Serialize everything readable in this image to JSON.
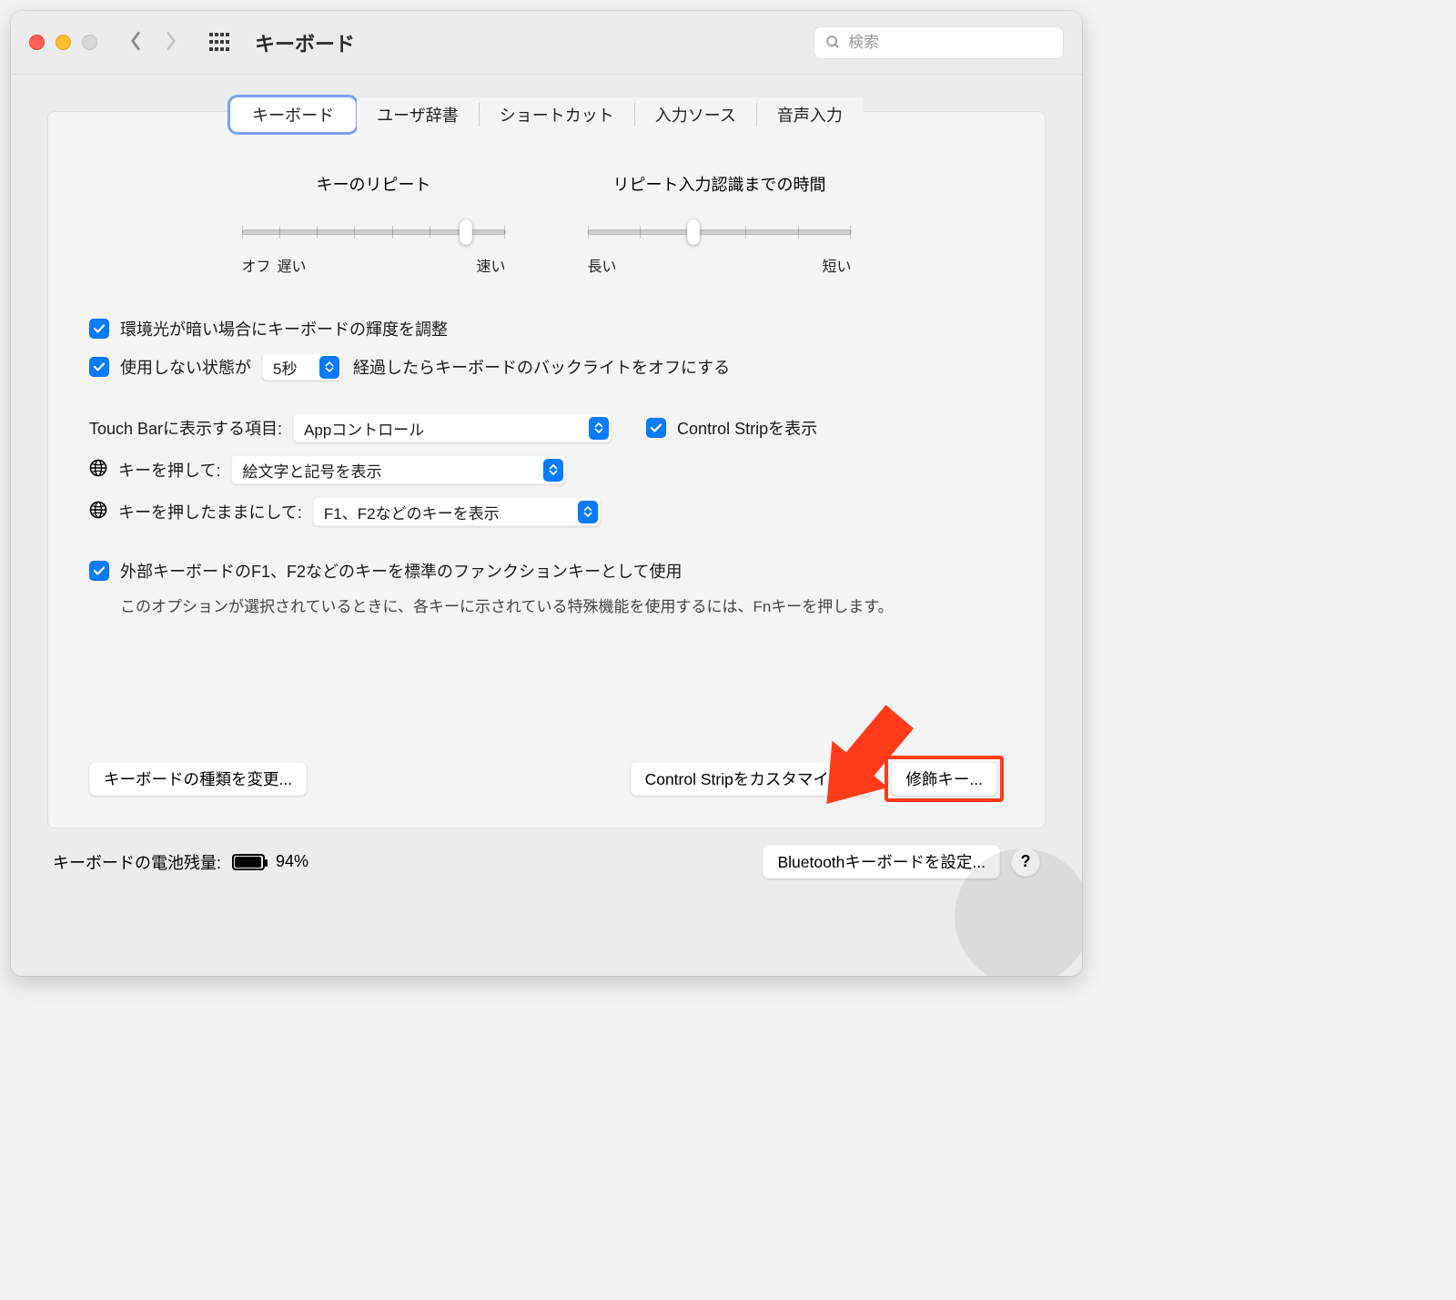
{
  "titlebar": {
    "title": "キーボード",
    "search_placeholder": "検索"
  },
  "tabs": {
    "keyboard": "キーボード",
    "userdict": "ユーザ辞書",
    "shortcut": "ショートカット",
    "inputsource": "入力ソース",
    "dictation": "音声入力"
  },
  "sliders": {
    "repeat": {
      "title": "キーのリピート",
      "min": "オフ",
      "min2": "遅い",
      "max": "速い"
    },
    "delay": {
      "title": "リピート入力認識までの時間",
      "min": "長い",
      "max": "短い"
    }
  },
  "checks": {
    "brightness": "環境光が暗い場合にキーボードの輝度を調整",
    "backlight_off_prefix": "使用しない状態が",
    "backlight_off_value": "5秒",
    "backlight_off_suffix": "経過したらキーボードのバックライトをオフにする",
    "touchbar_label": "Touch Barに表示する項目:",
    "touchbar_value": "Appコントロール",
    "control_strip": "Control Stripを表示",
    "globe_press_label": "キーを押して:",
    "globe_press_value": "絵文字と記号を表示",
    "globe_hold_label": "キーを押したままにして:",
    "globe_hold_value": "F1、F2などのキーを表示",
    "fn_keys": "外部キーボードのF1、F2などのキーを標準のファンクションキーとして使用",
    "fn_keys_note": "このオプションが選択されているときに、各キーに示されている特殊機能を使用するには、Fnキーを押します。"
  },
  "buttons": {
    "change_type": "キーボードの種類を変更...",
    "customize_control_strip": "Control Stripをカスタマイズ...",
    "modifier_keys": "修飾キー...",
    "bluetooth": "Bluetoothキーボードを設定..."
  },
  "footer": {
    "battery_label": "キーボードの電池残量:",
    "battery_value": "94%",
    "help": "?"
  }
}
